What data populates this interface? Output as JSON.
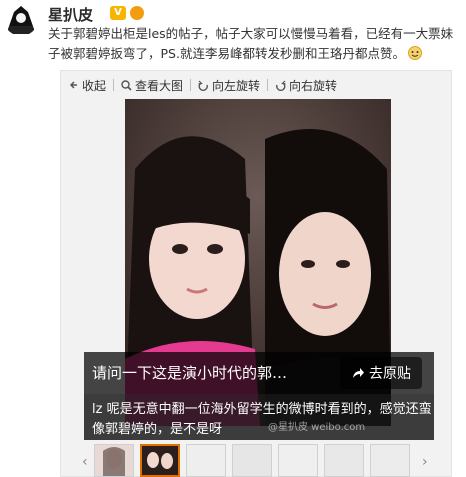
{
  "post": {
    "username": "星扒皮",
    "vip_badge": "V",
    "text": "关于郭碧婷出柜是les的帖子，帖子大家可以慢慢马着看，已经有一大票妹子被郭碧婷扳弯了，PS.就连李易峰都转发秒删和王珞丹都点赞。"
  },
  "toolbar": {
    "collapse_label": "收起",
    "view_large_label": "查看大图",
    "rotate_left_label": "向左旋转",
    "rotate_right_label": "向右旋转"
  },
  "image_overlay": {
    "question": "请问一下这是演小时代的郭…",
    "source_button": "去原贴",
    "caption": "lz 呢是无意中翻一位海外留学生的微博时看到的，感觉还蛮像郭碧婷的，是不是呀",
    "watermark": "@星扒皮 weibo.com"
  },
  "colors": {
    "accent_orange": "#e07000",
    "vip_gold": "#f7b500"
  }
}
